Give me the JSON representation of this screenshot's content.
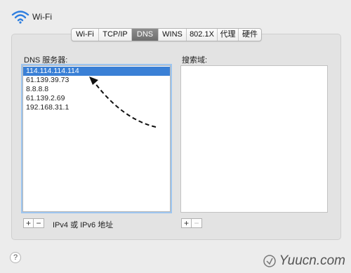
{
  "header": {
    "title": "Wi-Fi",
    "icon": "wifi-icon"
  },
  "tabs": [
    {
      "label": "Wi-Fi",
      "active": false
    },
    {
      "label": "TCP/IP",
      "active": false
    },
    {
      "label": "DNS",
      "active": true
    },
    {
      "label": "WINS",
      "active": false
    },
    {
      "label": "802.1X",
      "active": false
    },
    {
      "label": "代理",
      "active": false
    },
    {
      "label": "硬件",
      "active": false
    }
  ],
  "dns": {
    "label": "DNS 服务器:",
    "servers": [
      "114.114.114.114",
      "61.139.39.73",
      "8.8.8.8",
      "61.139.2.69",
      "192.168.31.1"
    ],
    "selected_index": 0,
    "hint": "IPv4 或 IPv6 地址"
  },
  "search_domains": {
    "label": "搜索域:",
    "items": []
  },
  "controls": {
    "add": "+",
    "remove": "−",
    "help": "?"
  },
  "watermark": {
    "text": "Yuucn.com"
  },
  "colors": {
    "selection": "#3a80d6",
    "active_tab": "#7a7a7a",
    "focus_ring": "#9ec6f0"
  }
}
